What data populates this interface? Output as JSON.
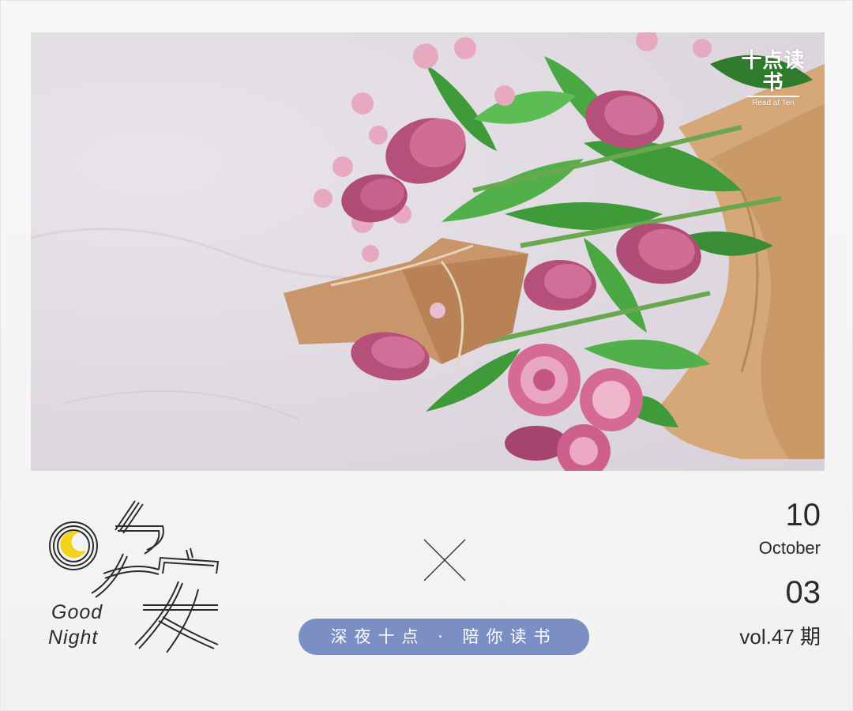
{
  "logo": {
    "text": "十点读书",
    "sub": "Read at Ten"
  },
  "goodnight": {
    "chars": "晚安",
    "line1": "Good",
    "line2": "Night"
  },
  "slogan": "深夜十点 · 陪你读书",
  "date": {
    "day": "10",
    "month": "October",
    "second": "03",
    "vol": "vol.47 期"
  },
  "colors": {
    "slogan_bg": "#7c8fc4",
    "moon": "#f3d21b",
    "text": "#2a2a2a"
  },
  "icons": [
    "moon-icon",
    "cross-icon"
  ]
}
